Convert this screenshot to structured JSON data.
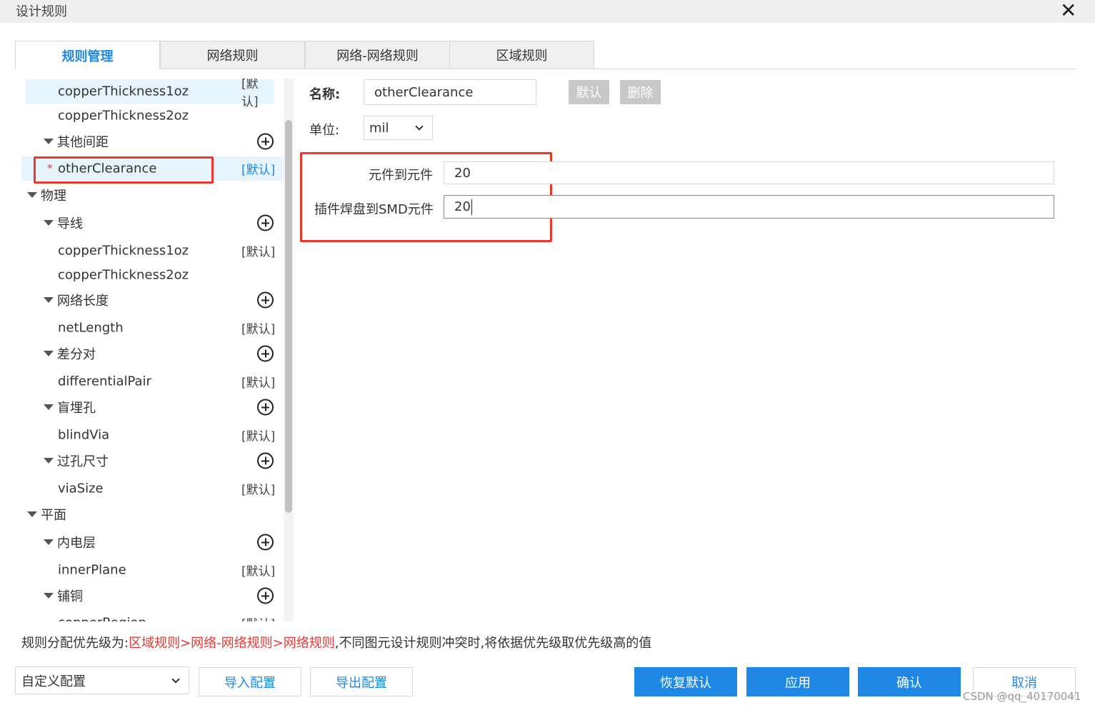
{
  "window": {
    "title": "设计规则"
  },
  "tabs": [
    "规则管理",
    "网络规则",
    "网络-网络规则",
    "区域规则"
  ],
  "tree": [
    {
      "label": "copperThickness1oz",
      "default": "[默认]"
    },
    {
      "label": "copperThickness2oz"
    },
    {
      "label": "其他间距"
    },
    {
      "label": "otherClearance",
      "default": "[默认]",
      "modified_mark": "*"
    },
    {
      "label": "物理"
    },
    {
      "label": "导线"
    },
    {
      "label": "copperThickness1oz",
      "default": "[默认]"
    },
    {
      "label": "copperThickness2oz"
    },
    {
      "label": "网络长度"
    },
    {
      "label": "netLength",
      "default": "[默认]"
    },
    {
      "label": "差分对"
    },
    {
      "label": "differentialPair",
      "default": "[默认]"
    },
    {
      "label": "盲埋孔"
    },
    {
      "label": "blindVia",
      "default": "[默认]"
    },
    {
      "label": "过孔尺寸"
    },
    {
      "label": "viaSize",
      "default": "[默认]"
    },
    {
      "label": "平面"
    },
    {
      "label": "内电层"
    },
    {
      "label": "innerPlane",
      "default": "[默认]"
    },
    {
      "label": "铺铜"
    },
    {
      "label": "copperRegion",
      "default": "[默认]"
    }
  ],
  "form": {
    "name_label": "名称:",
    "name_value": "otherClearance",
    "default_btn": "默认",
    "delete_btn": "删除",
    "unit_label": "单位:",
    "unit_value": "mil",
    "comp_to_comp_label": "元件到元件",
    "comp_to_comp_value": "20",
    "tht_to_smd_label": "插件焊盘到SMD元件",
    "tht_to_smd_value": "20"
  },
  "note": {
    "prefix": "规则分配优先级为:",
    "priority": "区域规则>网络-网络规则>网络规则",
    "suffix": ",不同图元设计规则冲突时,将依据优先级取优先级高的值"
  },
  "footer": {
    "config_select": "自定义配置",
    "import_btn": "导入配置",
    "export_btn": "导出配置",
    "restore_btn": "恢复默认",
    "apply_btn": "应用",
    "ok_btn": "确认",
    "cancel_btn": "取消"
  },
  "watermark": "CSDN @qq_40170041",
  "colors": {
    "accent": "#1f88e5",
    "highlight": "#e6f4fd",
    "annotation": "#f0352b",
    "disabled_button": "#c8c8c8"
  }
}
